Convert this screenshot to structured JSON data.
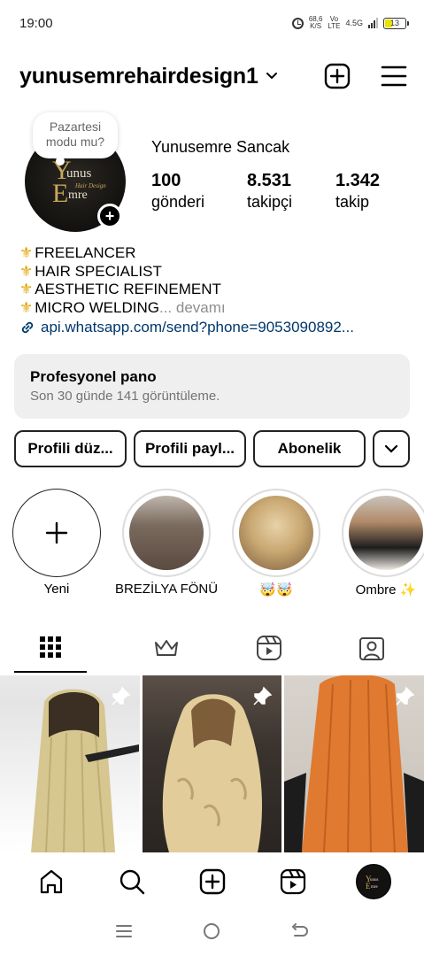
{
  "status": {
    "time": "19:00",
    "speed_value": "68,6",
    "speed_unit": "K/S",
    "volte_top": "Vo",
    "volte_bottom": "LTE",
    "network": "4.5G",
    "battery": "13"
  },
  "header": {
    "username": "yunusemrehairdesign1"
  },
  "profile": {
    "note": "Pazartesi modu mu?",
    "logo_top": "unus",
    "logo_sub": "Hair Design",
    "logo_bottom": "mre",
    "logo_initial_top": "Y",
    "logo_initial_bottom": "E",
    "full_name": "Yunusemre Sancak",
    "stats": [
      {
        "value": "100",
        "label": "gönderi"
      },
      {
        "value": "8.531",
        "label": "takipçi"
      },
      {
        "value": "1.342",
        "label": "takip"
      }
    ]
  },
  "bio": {
    "lines": [
      "FREELANCER",
      " HAIR SPECIALIST",
      " AESTHETIC REFINEMENT",
      " MICRO WELDING"
    ],
    "more_label": "... devamı",
    "link": "api.whatsapp.com/send?phone=9053090892..."
  },
  "dashboard": {
    "title": "Profesyonel pano",
    "subtitle": "Son 30 günde 141 görüntüleme."
  },
  "actions": {
    "edit": "Profili düz...",
    "share": "Profili payl...",
    "subscribe": "Abonelik"
  },
  "highlights": [
    {
      "label": "Yeni"
    },
    {
      "label": "BREZİLYA FÖNÜ"
    },
    {
      "label": "🤯🤯"
    },
    {
      "label": "Ombre ✨"
    }
  ],
  "tabs": [
    "grid-icon",
    "crown-icon",
    "reels-icon",
    "tagged-icon"
  ],
  "nav": [
    "home-icon",
    "search-icon",
    "create-icon",
    "reels-icon",
    "profile-avatar"
  ],
  "colors": {
    "link": "#00376b",
    "secondary": "#737373",
    "fleur": "#e0a400",
    "dashboard_bg": "#efefef"
  }
}
